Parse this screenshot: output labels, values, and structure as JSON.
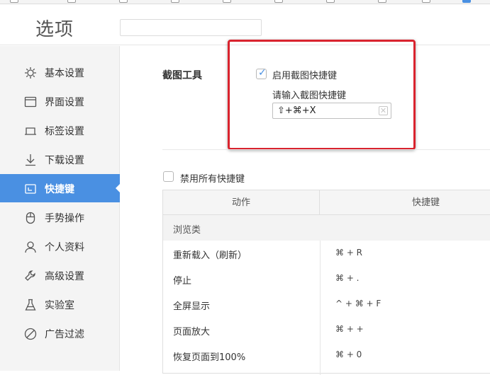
{
  "header": {
    "title": "选项",
    "search_placeholder": ""
  },
  "sidebar": {
    "items": [
      {
        "label": "基本设置",
        "icon": "sun-icon"
      },
      {
        "label": "界面设置",
        "icon": "window-icon"
      },
      {
        "label": "标签设置",
        "icon": "tab-icon"
      },
      {
        "label": "下载设置",
        "icon": "download-icon"
      },
      {
        "label": "快捷键",
        "icon": "shortcut-icon",
        "active": true
      },
      {
        "label": "手势操作",
        "icon": "mouse-icon"
      },
      {
        "label": "个人资料",
        "icon": "user-icon"
      },
      {
        "label": "高级设置",
        "icon": "wrench-icon"
      },
      {
        "label": "实验室",
        "icon": "flask-icon"
      },
      {
        "label": "广告过滤",
        "icon": "block-icon"
      }
    ]
  },
  "screenshot_tool": {
    "section_label": "截图工具",
    "enable_label": "启用截图快捷键",
    "enable_checked": true,
    "input_label": "请输入截图快捷键",
    "input_value": "⇧+⌘+X",
    "clear_symbol": "✕"
  },
  "disable_all": {
    "label": "禁用所有快捷键",
    "checked": false
  },
  "table": {
    "headers": {
      "action": "动作",
      "shortcut": "快捷键"
    },
    "group": "浏览类",
    "rows": [
      {
        "action": "重新载入（刷新）",
        "shortcut": "⌘ + R"
      },
      {
        "action": "停止",
        "shortcut": "⌘ + ."
      },
      {
        "action": "全屏显示",
        "shortcut": "^ + ⌘ + F"
      },
      {
        "action": "页面放大",
        "shortcut": "⌘ + +"
      },
      {
        "action": "恢复页面到100%",
        "shortcut": "⌘ + 0"
      }
    ]
  },
  "colors": {
    "accent": "#4a90e2",
    "annotation": "#d9232e",
    "sidebar_bg": "#f4f4f4"
  }
}
